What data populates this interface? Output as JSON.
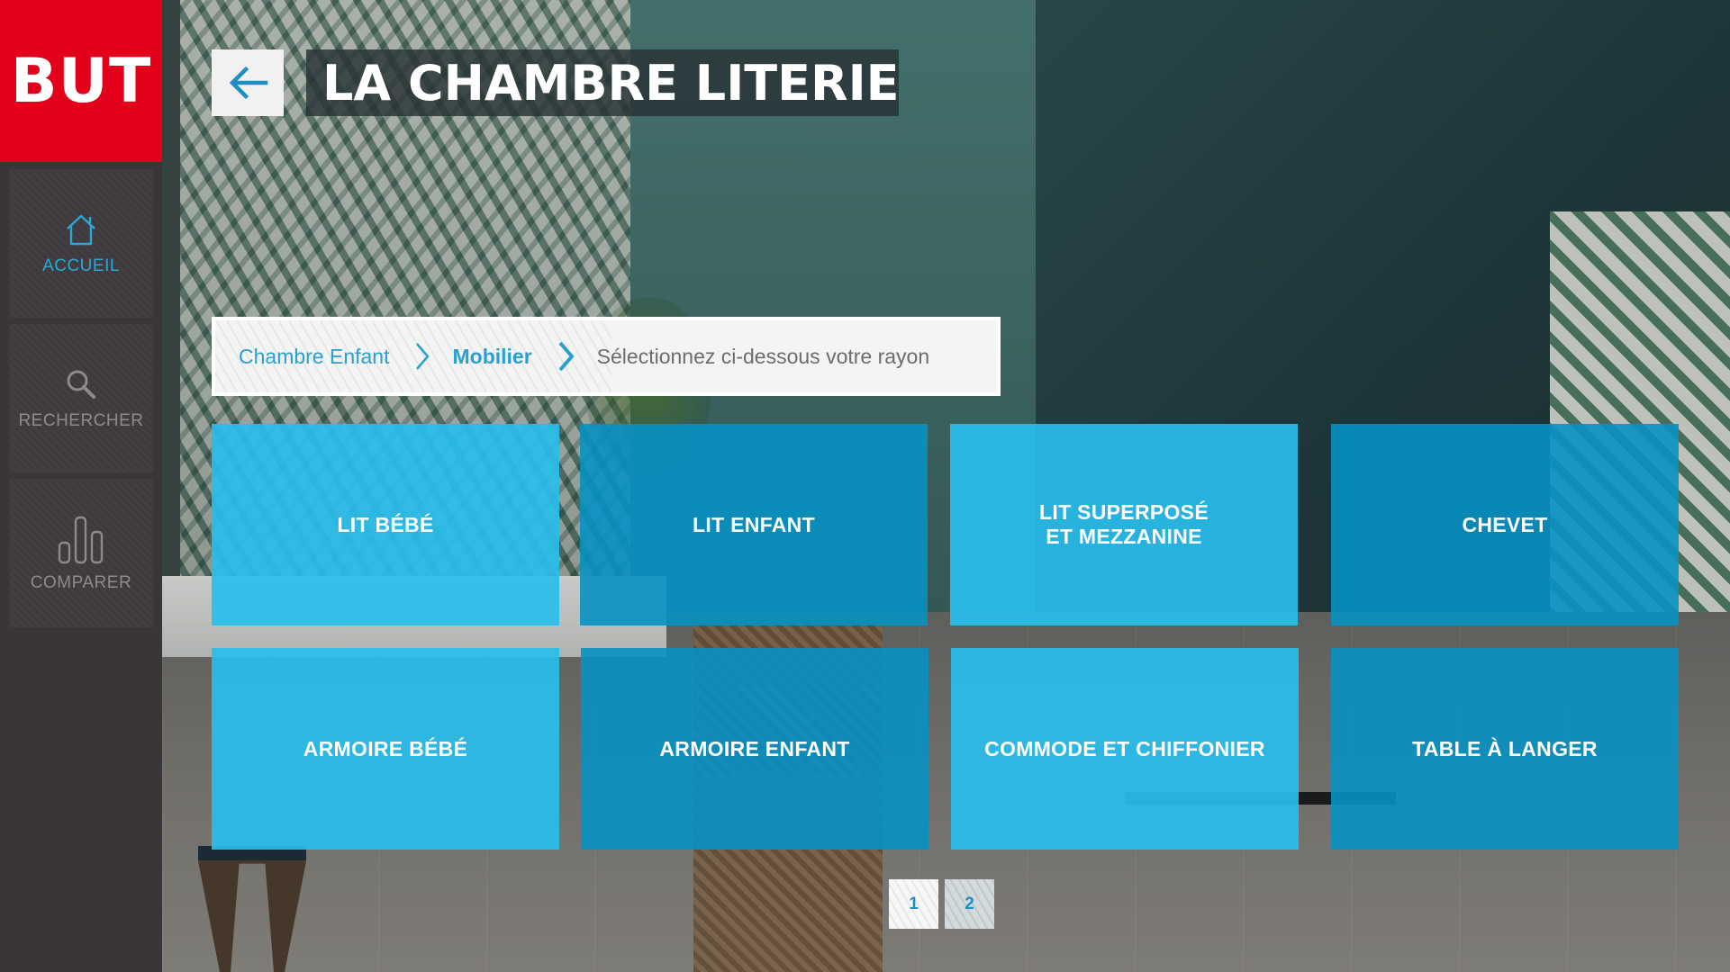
{
  "app": {
    "logo": "BUT"
  },
  "sidebar": {
    "items": [
      {
        "label": "ACCUEIL",
        "icon": "home-icon",
        "active": true
      },
      {
        "label": "RECHERCHER",
        "icon": "search-icon",
        "active": false
      },
      {
        "label": "COMPARER",
        "icon": "bar-chart-icon",
        "active": false
      }
    ]
  },
  "header": {
    "back_icon": "arrow-left-icon",
    "title": "LA CHAMBRE LITERIE"
  },
  "breadcrumb": {
    "items": [
      {
        "label": "Chambre Enfant"
      },
      {
        "label": "Mobilier"
      }
    ],
    "current": "Sélectionnez ci-dessous votre rayon",
    "separator_icon": "chevron-right-icon"
  },
  "categories": [
    {
      "label": "LIT BÉBÉ"
    },
    {
      "label": "LIT ENFANT"
    },
    {
      "label": "LIT SUPERPOSÉ\nET MEZZANINE"
    },
    {
      "label": "CHEVET"
    },
    {
      "label": "ARMOIRE BÉBÉ"
    },
    {
      "label": "ARMOIRE ENFANT"
    },
    {
      "label": "COMMODE ET CHIFFONIER"
    },
    {
      "label": "TABLE À LANGER"
    }
  ],
  "pagination": {
    "pages": [
      "1",
      "2"
    ],
    "current": "1"
  },
  "colors": {
    "brand_red": "#e2001a",
    "accent_blue": "#2aa7d6",
    "tile_light": "#28bee b",
    "tile_dark": "#0891c3",
    "sidebar_bg": "#3a3538"
  }
}
